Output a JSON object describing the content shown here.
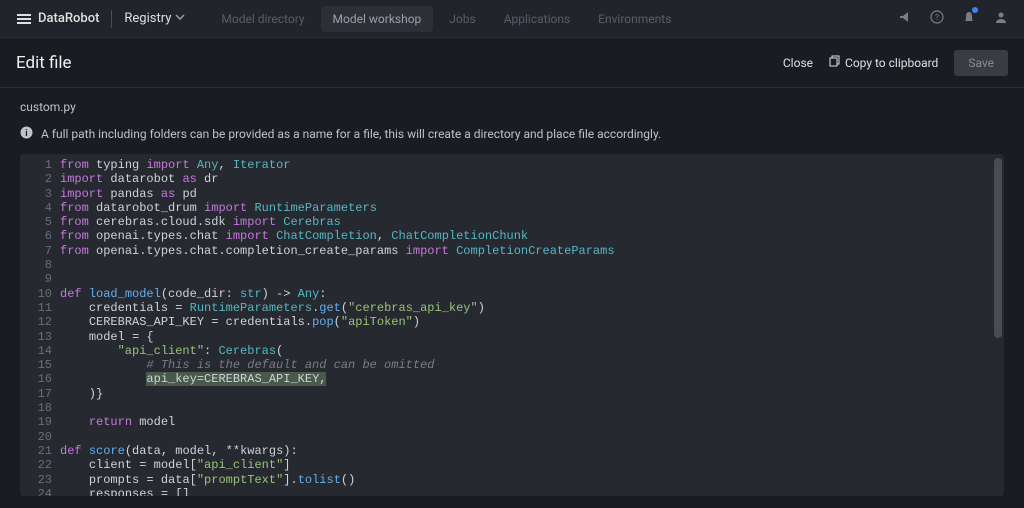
{
  "brand": "DataRobot",
  "app_name": "Registry",
  "nav_tabs": [
    {
      "label": "Model directory",
      "active": false
    },
    {
      "label": "Model workshop",
      "active": true
    },
    {
      "label": "Jobs",
      "active": false
    },
    {
      "label": "Applications",
      "active": false
    },
    {
      "label": "Environments",
      "active": false
    }
  ],
  "page_title": "Edit file",
  "close_label": "Close",
  "copy_label": "Copy to clipboard",
  "save_label": "Save",
  "filename": "custom.py",
  "hint_text": "A full path including folders can be provided as a name for a file, this will create a directory and place file accordingly.",
  "code_lines": [
    {
      "n": 1,
      "plain": "from typing import Any, Iterator",
      "tokens": [
        [
          "kw",
          "from"
        ],
        [
          "op",
          " "
        ],
        [
          "pa",
          "typing"
        ],
        [
          "op",
          " "
        ],
        [
          "kw",
          "import"
        ],
        [
          "op",
          " "
        ],
        [
          "ty",
          "Any"
        ],
        [
          "op",
          ", "
        ],
        [
          "ty",
          "Iterator"
        ]
      ]
    },
    {
      "n": 2,
      "plain": "import datarobot as dr",
      "tokens": [
        [
          "kw",
          "import"
        ],
        [
          "op",
          " "
        ],
        [
          "pa",
          "datarobot"
        ],
        [
          "op",
          " "
        ],
        [
          "kw",
          "as"
        ],
        [
          "op",
          " "
        ],
        [
          "pa",
          "dr"
        ]
      ]
    },
    {
      "n": 3,
      "plain": "import pandas as pd",
      "tokens": [
        [
          "kw",
          "import"
        ],
        [
          "op",
          " "
        ],
        [
          "pa",
          "pandas"
        ],
        [
          "op",
          " "
        ],
        [
          "kw",
          "as"
        ],
        [
          "op",
          " "
        ],
        [
          "pa",
          "pd"
        ]
      ]
    },
    {
      "n": 4,
      "plain": "from datarobot_drum import RuntimeParameters",
      "tokens": [
        [
          "kw",
          "from"
        ],
        [
          "op",
          " "
        ],
        [
          "pa",
          "datarobot_drum"
        ],
        [
          "op",
          " "
        ],
        [
          "kw",
          "import"
        ],
        [
          "op",
          " "
        ],
        [
          "ty",
          "RuntimeParameters"
        ]
      ]
    },
    {
      "n": 5,
      "plain": "from cerebras.cloud.sdk import Cerebras",
      "tokens": [
        [
          "kw",
          "from"
        ],
        [
          "op",
          " "
        ],
        [
          "pa",
          "cerebras.cloud.sdk"
        ],
        [
          "op",
          " "
        ],
        [
          "kw",
          "import"
        ],
        [
          "op",
          " "
        ],
        [
          "ty",
          "Cerebras"
        ]
      ]
    },
    {
      "n": 6,
      "plain": "from openai.types.chat import ChatCompletion, ChatCompletionChunk",
      "tokens": [
        [
          "kw",
          "from"
        ],
        [
          "op",
          " "
        ],
        [
          "pa",
          "openai.types.chat"
        ],
        [
          "op",
          " "
        ],
        [
          "kw",
          "import"
        ],
        [
          "op",
          " "
        ],
        [
          "ty",
          "ChatCompletion"
        ],
        [
          "op",
          ", "
        ],
        [
          "ty",
          "ChatCompletionChunk"
        ]
      ]
    },
    {
      "n": 7,
      "plain": "from openai.types.chat.completion_create_params import CompletionCreateParams",
      "tokens": [
        [
          "kw",
          "from"
        ],
        [
          "op",
          " "
        ],
        [
          "pa",
          "openai.types.chat.completion_create_params"
        ],
        [
          "op",
          " "
        ],
        [
          "kw",
          "import"
        ],
        [
          "op",
          " "
        ],
        [
          "ty",
          "CompletionCreateParams"
        ]
      ]
    },
    {
      "n": 8,
      "plain": "",
      "tokens": []
    },
    {
      "n": 9,
      "plain": "",
      "tokens": []
    },
    {
      "n": 10,
      "plain": "def load_model(code_dir: str) -> Any:",
      "tokens": [
        [
          "kw",
          "def"
        ],
        [
          "op",
          " "
        ],
        [
          "fn",
          "load_model"
        ],
        [
          "op",
          "("
        ],
        [
          "pa",
          "code_dir: "
        ],
        [
          "ty",
          "str"
        ],
        [
          "op",
          ") -> "
        ],
        [
          "ty",
          "Any"
        ],
        [
          "op",
          ":"
        ]
      ]
    },
    {
      "n": 11,
      "plain": "    credentials = RuntimeParameters.get(\"cerebras_api_key\")",
      "tokens": [
        [
          "op",
          "    "
        ],
        [
          "pa",
          "credentials"
        ],
        [
          "op",
          " = "
        ],
        [
          "ty",
          "RuntimeParameters"
        ],
        [
          "op",
          "."
        ],
        [
          "fn",
          "get"
        ],
        [
          "op",
          "("
        ],
        [
          "st",
          "\"cerebras_api_key\""
        ],
        [
          "op",
          ")"
        ]
      ]
    },
    {
      "n": 12,
      "plain": "    CEREBRAS_API_KEY = credentials.pop(\"apiToken\")",
      "tokens": [
        [
          "op",
          "    "
        ],
        [
          "pa",
          "CEREBRAS_API_KEY"
        ],
        [
          "op",
          " = "
        ],
        [
          "pa",
          "credentials"
        ],
        [
          "op",
          "."
        ],
        [
          "fn",
          "pop"
        ],
        [
          "op",
          "("
        ],
        [
          "st",
          "\"apiToken\""
        ],
        [
          "op",
          ")"
        ]
      ]
    },
    {
      "n": 13,
      "plain": "    model = {",
      "tokens": [
        [
          "op",
          "    "
        ],
        [
          "pa",
          "model"
        ],
        [
          "op",
          " = {"
        ]
      ]
    },
    {
      "n": 14,
      "plain": "        \"api_client\": Cerebras(",
      "tokens": [
        [
          "op",
          "        "
        ],
        [
          "st",
          "\"api_client\""
        ],
        [
          "op",
          ": "
        ],
        [
          "ty",
          "Cerebras"
        ],
        [
          "op",
          "("
        ]
      ]
    },
    {
      "n": 15,
      "plain": "            # This is the default and can be omitted",
      "tokens": [
        [
          "op",
          "            "
        ],
        [
          "cm",
          "# This is the default and can be omitted"
        ]
      ]
    },
    {
      "n": 16,
      "plain": "            api_key=CEREBRAS_API_KEY,",
      "highlight": true,
      "tokens": [
        [
          "op",
          "            "
        ],
        [
          "pa",
          "api_key"
        ],
        [
          "op",
          "="
        ],
        [
          "pa",
          "CEREBRAS_API_KEY"
        ],
        [
          "op",
          ","
        ]
      ]
    },
    {
      "n": 17,
      "plain": "    )}",
      "tokens": [
        [
          "op",
          "    )}"
        ]
      ]
    },
    {
      "n": 18,
      "plain": "",
      "tokens": []
    },
    {
      "n": 19,
      "plain": "    return model",
      "tokens": [
        [
          "op",
          "    "
        ],
        [
          "kw",
          "return"
        ],
        [
          "op",
          " "
        ],
        [
          "pa",
          "model"
        ]
      ]
    },
    {
      "n": 20,
      "plain": "",
      "tokens": []
    },
    {
      "n": 21,
      "plain": "def score(data, model, **kwargs):",
      "tokens": [
        [
          "kw",
          "def"
        ],
        [
          "op",
          " "
        ],
        [
          "fn",
          "score"
        ],
        [
          "op",
          "("
        ],
        [
          "pa",
          "data"
        ],
        [
          "op",
          ", "
        ],
        [
          "pa",
          "model"
        ],
        [
          "op",
          ", **"
        ],
        [
          "pa",
          "kwargs"
        ],
        [
          "op",
          "):"
        ]
      ]
    },
    {
      "n": 22,
      "plain": "    client = model[\"api_client\"]",
      "tokens": [
        [
          "op",
          "    "
        ],
        [
          "pa",
          "client"
        ],
        [
          "op",
          " = "
        ],
        [
          "pa",
          "model"
        ],
        [
          "op",
          "["
        ],
        [
          "st",
          "\"api_client\""
        ],
        [
          "op",
          "]"
        ]
      ]
    },
    {
      "n": 23,
      "plain": "    prompts = data[\"promptText\"].tolist()",
      "tokens": [
        [
          "op",
          "    "
        ],
        [
          "pa",
          "prompts"
        ],
        [
          "op",
          " = "
        ],
        [
          "pa",
          "data"
        ],
        [
          "op",
          "["
        ],
        [
          "st",
          "\"promptText\""
        ],
        [
          "op",
          "]."
        ],
        [
          "fn",
          "tolist"
        ],
        [
          "op",
          "()"
        ]
      ]
    },
    {
      "n": 24,
      "plain": "    responses = []",
      "tokens": [
        [
          "op",
          "    "
        ],
        [
          "pa",
          "responses"
        ],
        [
          "op",
          " = []"
        ]
      ]
    }
  ]
}
